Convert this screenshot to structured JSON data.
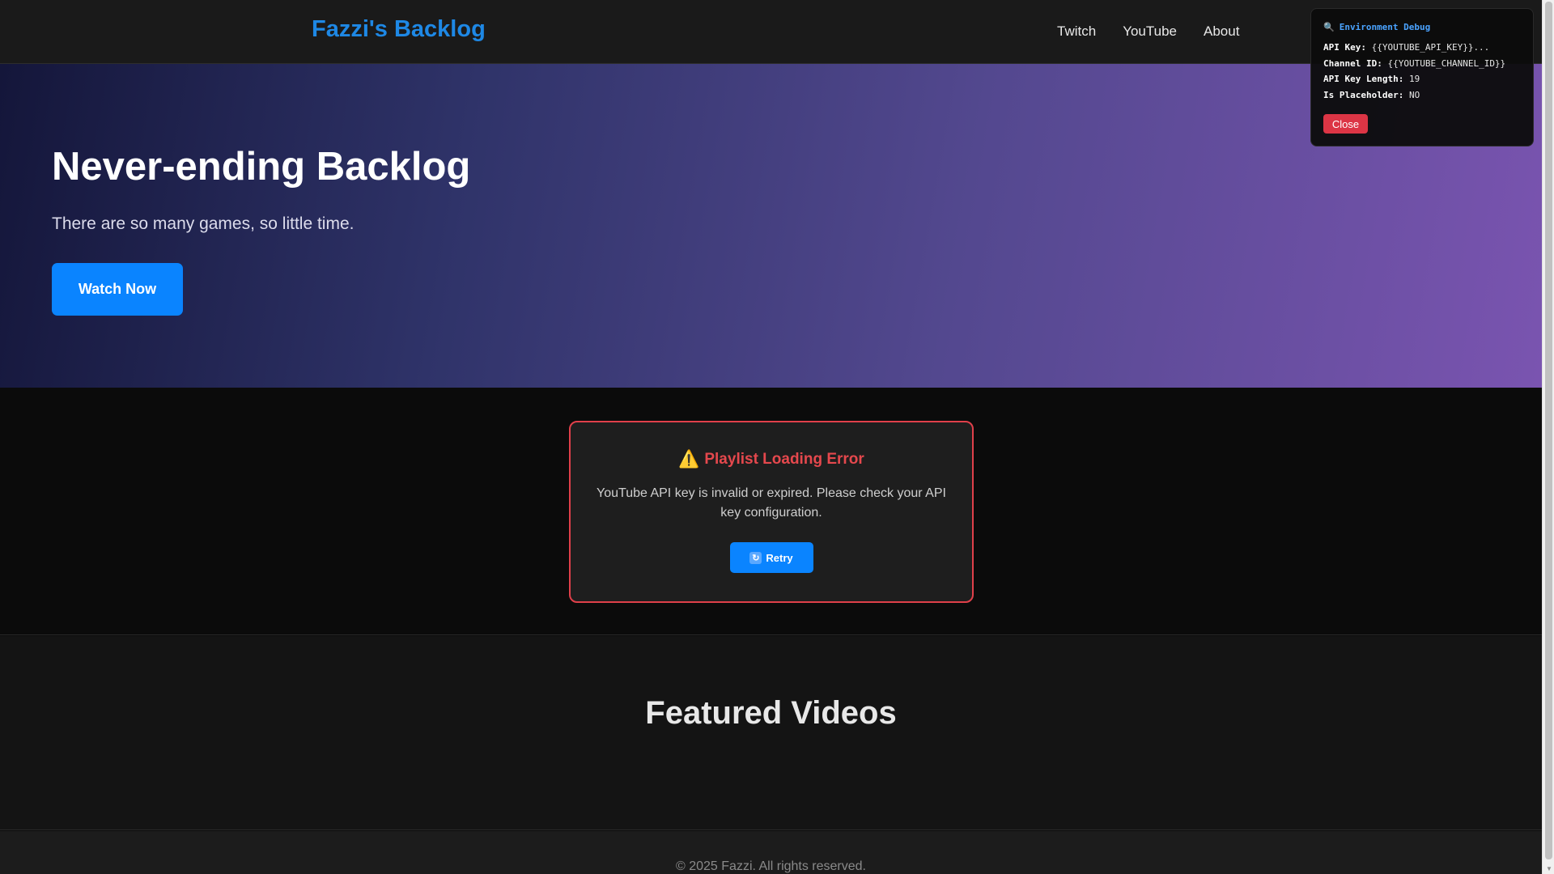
{
  "navbar": {
    "brand": "Fazzi's Backlog",
    "links": [
      "Twitch",
      "YouTube",
      "About"
    ]
  },
  "hero": {
    "title": "Never-ending Backlog",
    "subtitle": "There are so many games, so little time.",
    "cta": "Watch Now"
  },
  "error": {
    "icon": "warning-icon",
    "title": "Playlist Loading Error",
    "message": "YouTube API key is invalid or expired. Please check your API key configuration.",
    "retry_icon": "refresh-icon",
    "retry_label": "Retry",
    "border_color": "#e0404a"
  },
  "featured": {
    "title": "Featured Videos"
  },
  "footer": {
    "text": "© 2025 Fazzi. All rights reserved."
  },
  "debug": {
    "icon": "magnifier-icon",
    "title": "Environment Debug",
    "rows": [
      {
        "key": "API Key:",
        "value": "{{YOUTUBE_API_KEY}}..."
      },
      {
        "key": "Channel ID:",
        "value": "{{YOUTUBE_CHANNEL_ID}}"
      },
      {
        "key": "API Key Length:",
        "value": "19"
      },
      {
        "key": "Is Placeholder:",
        "value": "NO"
      }
    ],
    "close_label": "Close"
  },
  "colors": {
    "accent": "#0a84ff",
    "brand": "#1e88e5",
    "danger": "#dc3545"
  }
}
